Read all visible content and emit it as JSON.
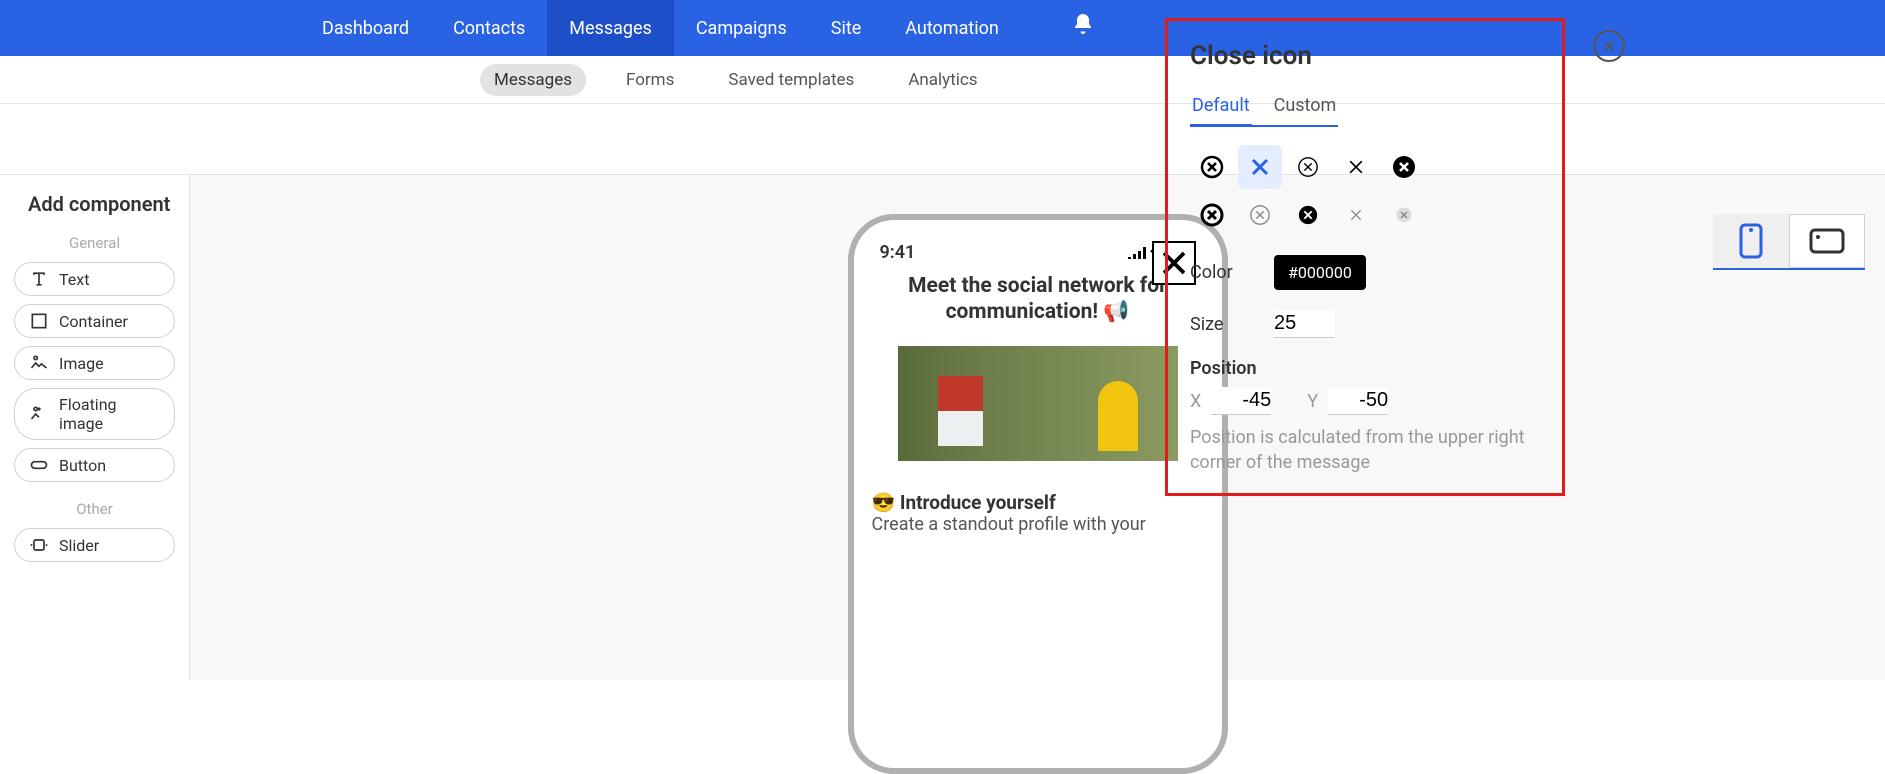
{
  "topnav": {
    "items": [
      "Dashboard",
      "Contacts",
      "Messages",
      "Campaigns",
      "Site",
      "Automation"
    ],
    "active": 2
  },
  "subnav": {
    "items": [
      "Messages",
      "Forms",
      "Saved templates",
      "Analytics"
    ],
    "active": 0
  },
  "sidebar": {
    "title": "Add component",
    "groups": [
      {
        "label": "General",
        "items": [
          {
            "icon": "text",
            "label": "Text"
          },
          {
            "icon": "container",
            "label": "Container"
          },
          {
            "icon": "image",
            "label": "Image"
          },
          {
            "icon": "floating-image",
            "label": "Floating image"
          },
          {
            "icon": "button",
            "label": "Button"
          }
        ]
      },
      {
        "label": "Other",
        "items": [
          {
            "icon": "slider",
            "label": "Slider"
          }
        ]
      }
    ]
  },
  "phone": {
    "time": "9:41",
    "title": "Meet the social network for communication! 📢",
    "section_emoji": "😎",
    "section_title": "Introduce yourself",
    "section_body": "Create a standout profile with your"
  },
  "panel": {
    "title": "Close icon",
    "tabs": [
      "Default",
      "Custom"
    ],
    "active_tab": 0,
    "color_label": "Color",
    "color_value": "#000000",
    "size_label": "Size",
    "size_value": "25",
    "position_label": "Position",
    "pos_x_label": "X",
    "pos_x_value": "-45",
    "pos_y_label": "Y",
    "pos_y_value": "-50",
    "position_help": "Position is calculated from the upper right corner of the message",
    "selected_icon_index": 1
  }
}
